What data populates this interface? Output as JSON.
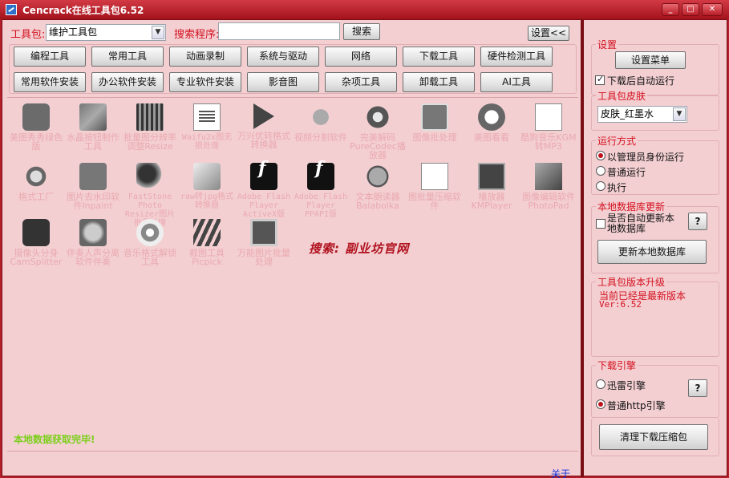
{
  "window": {
    "title": "Cencrack在线工具包6.52"
  },
  "toolbar": {
    "toolkit_label": "工具包:",
    "toolkit_value": "维护工具包",
    "search_label": "搜索程序:",
    "search_value": "",
    "search_button": "搜索",
    "settings_button": "设置<<"
  },
  "categories": [
    "编程工具",
    "常用工具",
    "动画录制",
    "系统与驱动",
    "网络",
    "下载工具",
    "硬件检测工具",
    "常用软件安装",
    "办公软件安装",
    "专业软件安装",
    "影音图",
    "杂项工具",
    "卸载工具",
    "AI工具"
  ],
  "tools": [
    {
      "label": "美图秀秀绿色版",
      "icon": "meitu-icon"
    },
    {
      "label": "水晶按钮制作工具",
      "icon": "crystal-button-icon"
    },
    {
      "label": "批量图分辨率调整Resize",
      "icon": "film-icon"
    },
    {
      "label": "Waifu2x图无损处理",
      "icon": "document-icon"
    },
    {
      "label": "万兴优转格式转换器",
      "icon": "play-icon"
    },
    {
      "label": "视频分割软件",
      "icon": "video-split-icon"
    },
    {
      "label": "完美解码PureCodec播放器",
      "icon": "gear-icon"
    },
    {
      "label": "图像批处理",
      "icon": "image-batch-icon"
    },
    {
      "label": "美图看看",
      "icon": "eye-icon"
    },
    {
      "label": "酷狗音乐KGM转MP3",
      "icon": "music-convert-icon"
    },
    {
      "label": "格式工厂",
      "icon": "format-factory-icon"
    },
    {
      "label": "图片去水印软件Inpaint",
      "icon": "inpaint-icon"
    },
    {
      "label": "FastStone Photo Resizer图片批量处理",
      "icon": "faststone-icon"
    },
    {
      "label": "raw转jpg格式转换器",
      "icon": "raw-converter-icon"
    },
    {
      "label": "Adobe Flash Player ActiveX版",
      "icon": "flash-icon"
    },
    {
      "label": "Adobe Flash Player PPAPI版",
      "icon": "flash-icon"
    },
    {
      "label": "文本朗读器Balabolka",
      "icon": "balabolka-icon"
    },
    {
      "label": "图批量压缩软件",
      "icon": "compress-icon"
    },
    {
      "label": "播放器KMPlayer",
      "icon": "kmplayer-icon"
    },
    {
      "label": "图像编辑软件PhotoPad",
      "icon": "photopad-icon"
    },
    {
      "label": "摄像头分身CamSplitter",
      "icon": "camsplitter-icon"
    },
    {
      "label": "伴奏人声分离软件伴奏",
      "icon": "vocal-split-icon"
    },
    {
      "label": "音乐格式解锁工具",
      "icon": "music-unlock-icon"
    },
    {
      "label": "截图工具Picpick",
      "icon": "picpick-icon"
    },
    {
      "label": "万能图片批量处理",
      "icon": "image-batch-icon"
    }
  ],
  "promo_text": "搜索: 副业坊官网",
  "status_text": "本地数据获取完毕!",
  "about_link": "关于",
  "settings": {
    "group_title": "设置",
    "menu_button": "设置菜单",
    "auto_run_label": "下载后自动运行",
    "auto_run_checked": true
  },
  "skin": {
    "group_title": "工具包皮肤",
    "value": "皮肤_红墨水"
  },
  "run_mode": {
    "group_title": "运行方式",
    "options": [
      "以管理员身份运行",
      "普通运行",
      "执行"
    ],
    "selected": 0
  },
  "local_db": {
    "group_title": "本地数据库更新",
    "auto_update_label": "是否自动更新本地数据库",
    "help_button": "?",
    "update_button": "更新本地数据库"
  },
  "version": {
    "group_title": "工具包版本升级",
    "status": "当前已经是最新版本",
    "version": "Ver:6.52"
  },
  "download_engine": {
    "group_title": "下载引擎",
    "options": [
      "迅雷引擎",
      "普通http引擎"
    ],
    "selected": 1,
    "help_button": "?"
  },
  "clean_button": "清理下载压缩包",
  "colors": {
    "title_bar": "#b3202a",
    "panel_bg": "#f3cfd2",
    "accent_red": "#d4101e",
    "status_green": "#7ccf1c"
  }
}
